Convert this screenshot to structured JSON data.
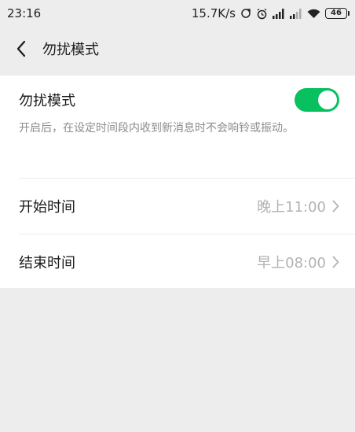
{
  "status_bar": {
    "time": "23:16",
    "net_speed": "15.7K/s",
    "battery": "46",
    "icons": [
      "sync-icon",
      "alarm-icon",
      "signal-icon",
      "signal-weak-icon",
      "wifi-icon",
      "battery-icon"
    ]
  },
  "header": {
    "title": "勿扰模式",
    "back_icon": "chevron-left-icon"
  },
  "dnd": {
    "label": "勿扰模式",
    "enabled": true,
    "description": "开启后，在设定时间段内收到新消息时不会响铃或振动。"
  },
  "schedule": {
    "start": {
      "label": "开始时间",
      "value": "晚上11:00"
    },
    "end": {
      "label": "结束时间",
      "value": "早上08:00"
    }
  },
  "colors": {
    "accent": "#07c160",
    "background": "#ededed",
    "card": "#ffffff",
    "secondary_text": "#8c8c8c",
    "value_text": "#b2b2b2"
  }
}
